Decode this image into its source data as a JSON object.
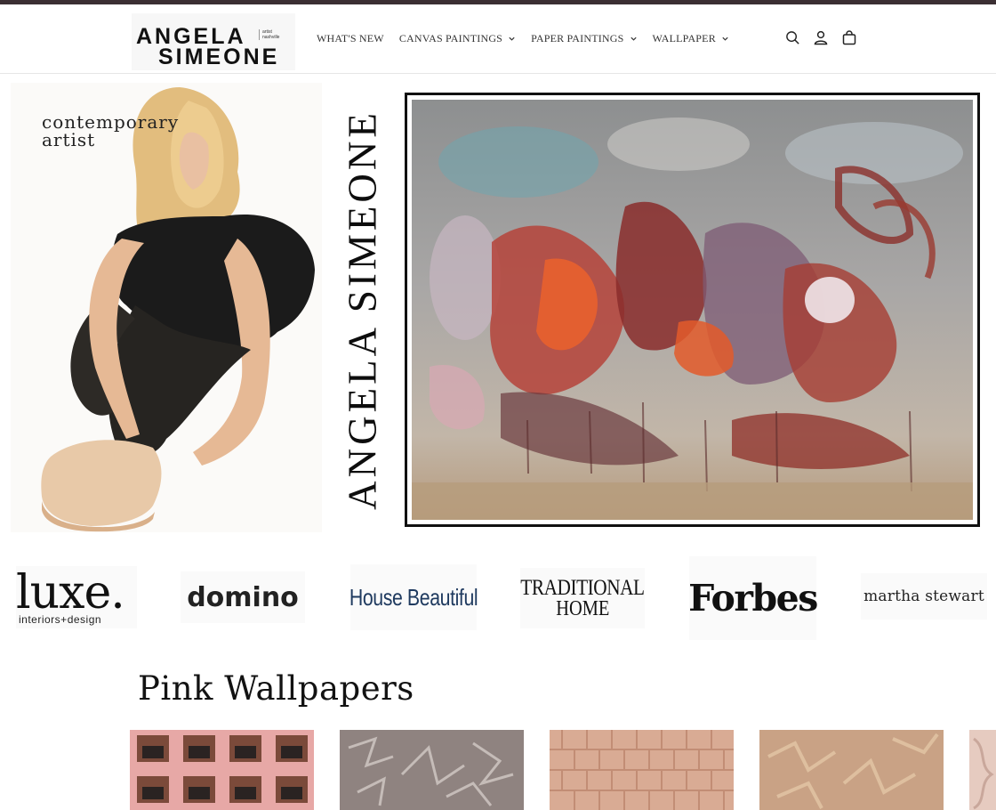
{
  "brand": {
    "line1": "ANGELA",
    "line2": "SIMEONE",
    "tag": "artist nashville"
  },
  "nav": {
    "items": [
      {
        "label": "WHAT'S NEW",
        "dropdown": false
      },
      {
        "label": "CANVAS PAINTINGS",
        "dropdown": true
      },
      {
        "label": "PAPER PAINTINGS",
        "dropdown": true
      },
      {
        "label": "WALLPAPER",
        "dropdown": true
      }
    ]
  },
  "header_icons": [
    "search-icon",
    "account-icon",
    "cart-icon"
  ],
  "hero": {
    "tagline": "contemporary artist",
    "vertical_name": "ANGELA SIMEONE"
  },
  "press": {
    "luxe_main": "luxe.",
    "luxe_sub": "interiors+design",
    "domino": "domino",
    "house_beautiful": "House Beautiful",
    "traditional_home_1": "TRADITIONAL",
    "traditional_home_2": "HOME",
    "forbes": "Forbes",
    "martha": "martha stewart"
  },
  "collection": {
    "title": "Pink Wallpapers"
  },
  "colors": {
    "topbar": "#3b2f33",
    "house_beautiful": "#1f3a5f"
  }
}
